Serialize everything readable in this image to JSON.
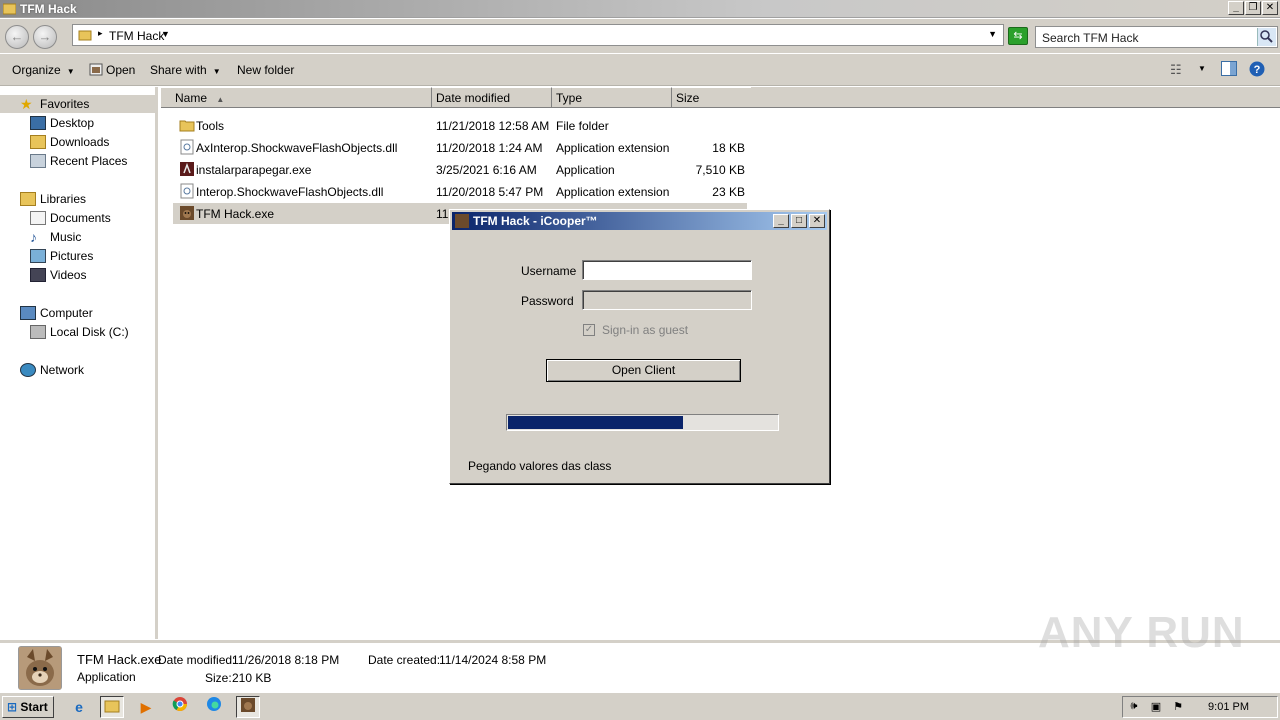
{
  "window": {
    "title": "TFM Hack",
    "controls": {
      "minimize": "_",
      "maximize": "❐",
      "close": "✕"
    }
  },
  "address": {
    "crumb": "TFM Hack",
    "search_placeholder": "Search TFM Hack"
  },
  "toolbar": {
    "organize": "Organize",
    "open": "Open",
    "share_with": "Share with",
    "new_folder": "New folder"
  },
  "sidebar": {
    "favorites": "Favorites",
    "desktop": "Desktop",
    "downloads": "Downloads",
    "recent_places": "Recent Places",
    "libraries": "Libraries",
    "documents": "Documents",
    "music": "Music",
    "pictures": "Pictures",
    "videos": "Videos",
    "computer": "Computer",
    "local_disk": "Local Disk (C:)",
    "network": "Network"
  },
  "columns": {
    "name": "Name",
    "date_modified": "Date modified",
    "type": "Type",
    "size": "Size"
  },
  "files": [
    {
      "name": "Tools",
      "date": "11/21/2018 12:58 AM",
      "type": "File folder",
      "size": "",
      "icon": "folder-icon"
    },
    {
      "name": "AxInterop.ShockwaveFlashObjects.dll",
      "date": "11/20/2018 1:24 AM",
      "type": "Application extension",
      "size": "18 KB",
      "icon": "dll-icon"
    },
    {
      "name": "instalarparapegar.exe",
      "date": "3/25/2021 6:16 AM",
      "type": "Application",
      "size": "7,510 KB",
      "icon": "exe-icon"
    },
    {
      "name": "Interop.ShockwaveFlashObjects.dll",
      "date": "11/20/2018 5:47 PM",
      "type": "Application extension",
      "size": "23 KB",
      "icon": "dll-icon"
    },
    {
      "name": "TFM Hack.exe",
      "date": "11",
      "type": "",
      "size": "",
      "icon": "app-icon"
    }
  ],
  "details": {
    "filename": "TFM Hack.exe",
    "kind": "Application",
    "date_modified_label": "Date modified:",
    "date_modified": "11/26/2018 8:18 PM",
    "date_created_label": "Date created:",
    "date_created": "11/14/2024 8:58 PM",
    "size_label": "Size:",
    "size": "210 KB"
  },
  "watermark": "ANY RUN",
  "dialog": {
    "title": "TFM Hack - iCooper™",
    "username_label": "Username",
    "username_value": "",
    "password_label": "Password",
    "password_value": "",
    "guest_label": "Sign-in as guest",
    "guest_checked": true,
    "button_label": "Open Client",
    "progress": 0.65,
    "status": "Pegando valores das class"
  },
  "taskbar": {
    "start_label": "Start",
    "clock": "9:01 PM"
  }
}
